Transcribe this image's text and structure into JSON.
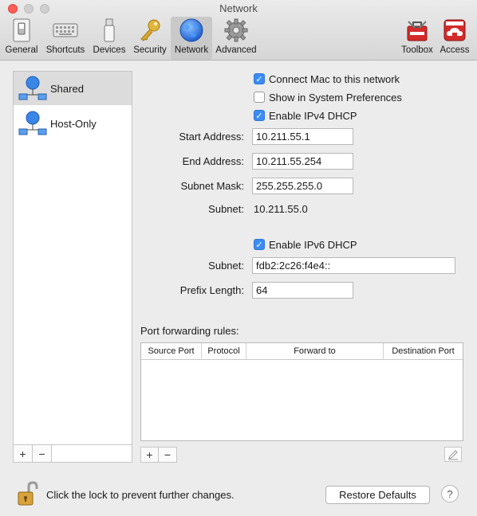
{
  "window": {
    "title": "Network"
  },
  "toolbar": {
    "items": [
      {
        "label": "General",
        "icon": "general-icon"
      },
      {
        "label": "Shortcuts",
        "icon": "keyboard-icon"
      },
      {
        "label": "Devices",
        "icon": "usb-device-icon"
      },
      {
        "label": "Security",
        "icon": "key-icon"
      },
      {
        "label": "Network",
        "icon": "globe-icon",
        "selected": true
      },
      {
        "label": "Advanced",
        "icon": "gear-icon"
      },
      {
        "label": "Toolbox",
        "icon": "toolbox-icon"
      },
      {
        "label": "Access",
        "icon": "cloud-access-icon"
      }
    ]
  },
  "network_list": {
    "items": [
      {
        "label": "Shared",
        "selected": true
      },
      {
        "label": "Host-Only",
        "selected": false
      }
    ],
    "add_label": "+",
    "remove_label": "−"
  },
  "settings": {
    "connect_mac": {
      "label": "Connect Mac to this network",
      "checked": true
    },
    "show_in_sys_prefs": {
      "label": "Show in System Preferences",
      "checked": false
    },
    "enable_ipv4": {
      "label": "Enable IPv4 DHCP",
      "checked": true
    },
    "start_address": {
      "label": "Start Address:",
      "value": "10.211.55.1"
    },
    "end_address": {
      "label": "End Address:",
      "value": "10.211.55.254"
    },
    "subnet_mask": {
      "label": "Subnet Mask:",
      "value": "255.255.255.0"
    },
    "subnet_ipv4": {
      "label": "Subnet:",
      "value": "10.211.55.0"
    },
    "enable_ipv6": {
      "label": "Enable IPv6 DHCP",
      "checked": true
    },
    "subnet_ipv6": {
      "label": "Subnet:",
      "value": "fdb2:2c26:f4e4::"
    },
    "prefix_length": {
      "label": "Prefix Length:",
      "value": "64"
    }
  },
  "port_forwarding": {
    "title": "Port forwarding rules:",
    "columns": [
      "Source Port",
      "Protocol",
      "Forward to",
      "Destination Port"
    ],
    "rows": [],
    "add_label": "+",
    "remove_label": "−"
  },
  "footer": {
    "lock_text": "Click the lock to prevent further changes.",
    "restore_label": "Restore Defaults",
    "help_label": "?"
  },
  "colors": {
    "accent": "#3b8cf5",
    "close": "#fd5f57"
  }
}
